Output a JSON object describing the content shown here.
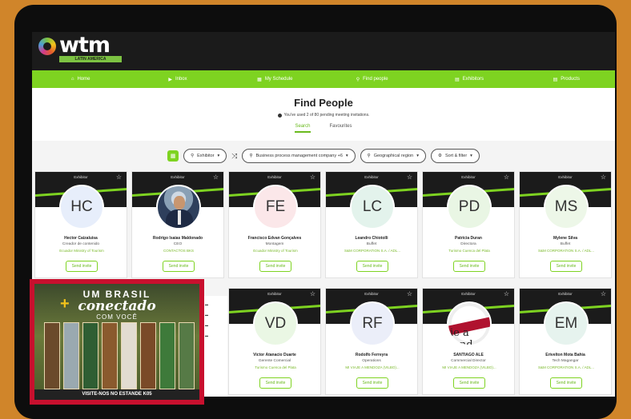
{
  "header": {
    "logo_text": "wtm",
    "logo_sub": "LATIN AMERICA"
  },
  "nav": [
    {
      "icon": "⌂",
      "label": "Home",
      "name": "nav-home",
      "icon_name": "home-icon"
    },
    {
      "icon": "▶",
      "label": "Inbox",
      "name": "nav-inbox",
      "icon_name": "inbox-icon"
    },
    {
      "icon": "▦",
      "label": "My Schedule",
      "name": "nav-schedule",
      "icon_name": "calendar-icon"
    },
    {
      "icon": "⚲",
      "label": "Find people",
      "name": "nav-find-people",
      "icon_name": "search-icon"
    },
    {
      "icon": "▤",
      "label": "Exhibitors",
      "name": "nav-exhibitors",
      "icon_name": "exhibitors-icon"
    },
    {
      "icon": "▤",
      "label": "Products",
      "name": "nav-products",
      "icon_name": "products-icon"
    }
  ],
  "page": {
    "title": "Find People",
    "notice": "You've used 2 of 80 pending meeting invitations.",
    "tabs": [
      "Search",
      "Favourites"
    ]
  },
  "filters": {
    "exhibitor": "Exhibitor",
    "keyword": "Business process management company +6",
    "region": "Geographical region",
    "sort": "Sort & filter"
  },
  "cards": [
    {
      "badge": "Exhibitor",
      "initials": "HC",
      "color": "#e7eefb",
      "name": "Hector Caizaluisa",
      "role": "Creador de contenido",
      "company": "Ecuador Ministry of Tourism",
      "button": "Send invite"
    },
    {
      "badge": "Exhibitor",
      "initials": "",
      "photo": "photo",
      "name": "Rodrigo Isaias Maldonado",
      "role": "CEO",
      "company": "CONTACTOS BKS",
      "button": "Send invite"
    },
    {
      "badge": "Exhibitor",
      "initials": "FE",
      "color": "#fbe7e9",
      "name": "Francisco Edvan Gonçalves",
      "role": "Montagem",
      "company": "Ecuador Ministry of Tourism",
      "button": "Send invite"
    },
    {
      "badge": "Exhibitor",
      "initials": "LC",
      "color": "#e3f3ec",
      "name": "Leandro Chiotolli",
      "role": "Buffet",
      "company": "S&M CORPORATION S.A. / ADL...",
      "button": "Send invite"
    },
    {
      "badge": "Exhibitor",
      "initials": "PD",
      "color": "#e9f6e4",
      "name": "Patricia Duran",
      "role": "Directora",
      "company": "Turismo Cuenca del Plata",
      "button": "Send invite"
    },
    {
      "badge": "Exhibitor",
      "initials": "MS",
      "color": "#edf7e8",
      "name": "Mylene Silva",
      "role": "Buffet",
      "company": "S&M CORPORATION S.A. / ADL...",
      "button": "Send invite"
    },
    {
      "badge": "Exhibitor",
      "initials": "VD",
      "color": "#eaf7e4",
      "name": "Victor Atanacio Duarte",
      "role": "Gerente Comercial",
      "company": "Turismo Cuenca del Plata",
      "button": "Send invite"
    },
    {
      "badge": "Exhibitor",
      "initials": "RF",
      "color": "#ebeef9",
      "name": "Rodolfo Ferreyra",
      "role": "Operations",
      "company": "MI VIAJE A MENDOZA (VILBO)...",
      "button": "Send invite"
    },
    {
      "badge": "Exhibitor",
      "initials": "",
      "photo": "photo2",
      "photo_text": "ie a  lend",
      "name": "SANTIAGO ALE",
      "role": "Commercial Director",
      "company": "MI VIAJE A MENDOZA (VILBO)...",
      "button": "Send invite"
    },
    {
      "badge": "Exhibitor",
      "initials": "EM",
      "color": "#e6f3ee",
      "name": "Erivelton Mota Bahia",
      "role": "Tech Magangar",
      "company": "S&M CORPORATION S.A. / ADL...",
      "button": "Send invite"
    }
  ],
  "ad": {
    "line1": "UM BRASIL",
    "line2": "conectado",
    "line3": "COM VOCÊ",
    "footer": "VISITE-NOS NO ESTANDE K05",
    "border_color": "#c8102e"
  }
}
